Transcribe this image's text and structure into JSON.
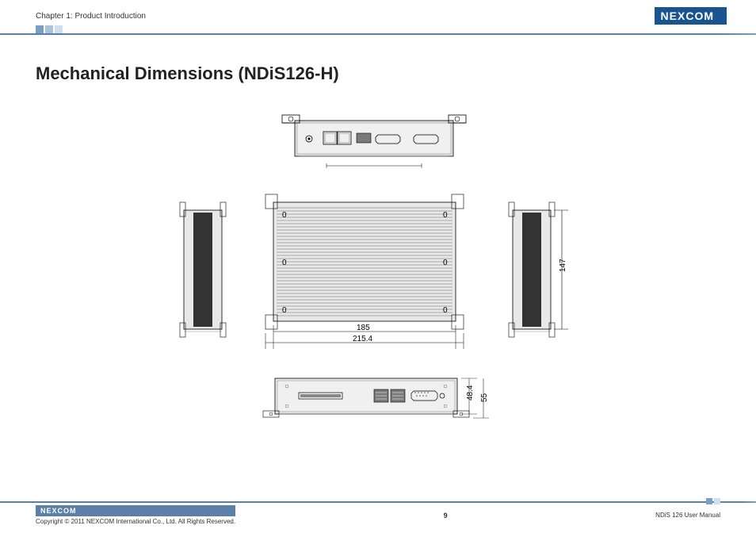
{
  "header": {
    "chapter": "Chapter 1: Product Introduction",
    "logo": "NEXCOM"
  },
  "title": "Mechanical Dimensions (NDiS126-H)",
  "dims": {
    "width_inner": "185",
    "width_outer": "215.4",
    "depth": "147",
    "height_inner": "48.4",
    "height_outer": "55"
  },
  "markers": {
    "screw": "0"
  },
  "footer": {
    "logo": "NEXCOM",
    "copyright": "Copyright © 2011 NEXCOM International Co., Ltd. All Rights Reserved.",
    "page": "9",
    "manual": "NDiS 126 User Manual"
  }
}
